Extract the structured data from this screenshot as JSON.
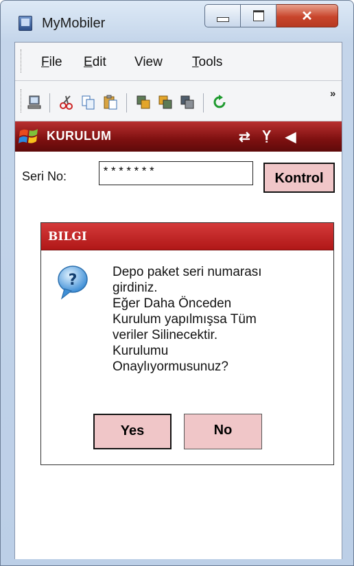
{
  "window": {
    "title": "MyMobiler"
  },
  "menu": {
    "file": "File",
    "edit": "Edit",
    "view": "View",
    "tools": "Tools"
  },
  "toolbar": {
    "overflow": "»"
  },
  "device": {
    "title": "KURULUM",
    "serial_label": "Seri No:",
    "serial_value": "*******",
    "check_button": "Kontrol"
  },
  "dialog": {
    "title": "BILGI",
    "message_lines": [
      "Depo paket seri numarası",
      "girdiniz.",
      "Eğer Daha Önceden",
      "Kurulum yapılmışsa Tüm",
      "veriler Silinecektir.",
      "Kurulumu",
      "Onaylıyormusunuz?"
    ],
    "yes": "Yes",
    "no": "No"
  },
  "colors": {
    "device_bar": "#8a1414",
    "dialog_title": "#c62626",
    "button_fill": "#f0c6c8"
  }
}
